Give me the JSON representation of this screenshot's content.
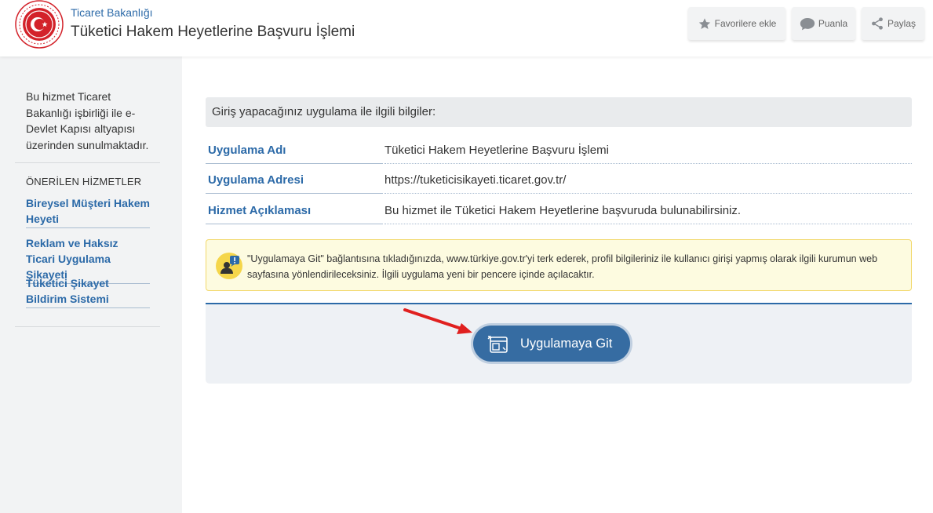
{
  "header": {
    "ministry": "Ticaret Bakanlığı",
    "title": "Tüketici Hakem Heyetlerine Başvuru İşlemi",
    "favorite_label": "Favorilere ekle",
    "rate_label": "Puanla",
    "share_label": "Paylaş"
  },
  "sidebar": {
    "info": "Bu hizmet Ticaret Bakanlığı işbirliği ile e-Devlet Kapısı altyapısı üzerinden sunulmaktadır.",
    "recommended_heading": "ÖNERİLEN HİZMETLER",
    "links": [
      {
        "label": "Bireysel Müşteri Hakem Heyeti"
      },
      {
        "label": "Reklam ve Haksız Ticari Uygulama Şikayeti"
      },
      {
        "label": "Tüketici Şikayet Bildirim Sistemi"
      }
    ]
  },
  "main": {
    "info_header": "Giriş yapacağınız uygulama ile ilgili bilgiler:",
    "rows": [
      {
        "label": "Uygulama Adı",
        "value": "Tüketici Hakem Heyetlerine Başvuru İşlemi"
      },
      {
        "label": "Uygulama Adresi",
        "value": "https://tuketicisikayeti.ticaret.gov.tr/"
      },
      {
        "label": "Hizmet Açıklaması",
        "value": "Bu hizmet ile Tüketici Hakem Heyetlerine başvuruda bulunabilirsiniz."
      }
    ],
    "notice": "\"Uygulamaya Git\" bağlantısına tıkladığınızda, www.türkiye.gov.tr'yi terk ederek, profil bilgileriniz ile kullanıcı girişi yapmış olarak ilgili kurumun web sayfasına yönlendirileceksiniz. İlgili uygulama yeni bir pencere içinde açılacaktır.",
    "go_button": "Uygulamaya Git"
  },
  "colors": {
    "brand_blue": "#2c6aa8",
    "button_blue": "#366ca2",
    "logo_red": "#d3222a",
    "arrow_red": "#e0201f",
    "notice_bg": "#fdfbe0"
  },
  "icons": {
    "favorite": "star-icon",
    "rate": "speech-bubble-icon",
    "share": "share-icon",
    "notice": "user-info-icon",
    "go": "open-window-icon",
    "logo": "ministry-emblem-logo"
  }
}
